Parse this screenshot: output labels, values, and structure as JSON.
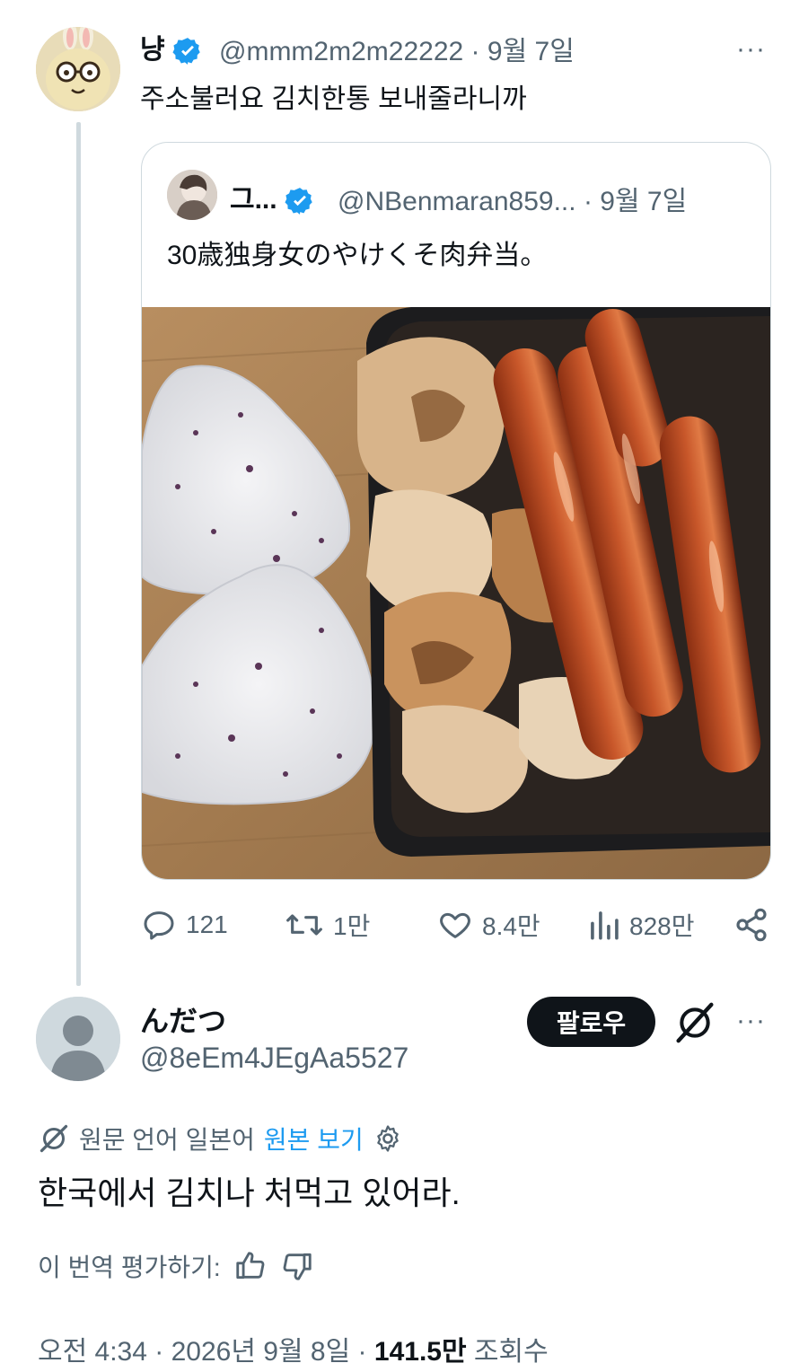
{
  "original_tweet": {
    "name": "냥",
    "handle": "@mmm2m2m22222",
    "date": "9월 7일",
    "text": "주소불러요 김치한통 보내줄라니까",
    "more": "···"
  },
  "quoted_tweet": {
    "name": "그...",
    "handle": "@NBenmaran859...",
    "date": "9월 7일",
    "text": "30歳独身女のやけくそ肉弁当。"
  },
  "actions": {
    "replies": "121",
    "retweets": "1만",
    "likes": "8.4만",
    "views": "828만"
  },
  "reply_tweet": {
    "name": "んだつ",
    "handle": "@8eEm4JEgAa5527",
    "follow_label": "팔로우",
    "more": "···",
    "translation_label": "원문 언어 일본어",
    "translation_link": "원본 보기",
    "text": "한국에서 김치나 처먹고 있어라.",
    "rate_label": "이 번역 평가하기:",
    "time": "오전 4:34",
    "date": "2026년 9월 8일",
    "views_count": "141.5만",
    "views_label": "조회수",
    "sep": "·"
  },
  "colors": {
    "accent": "#1d9bf0",
    "text": "#0f1419",
    "muted": "#536471",
    "border": "#cfd9de"
  }
}
